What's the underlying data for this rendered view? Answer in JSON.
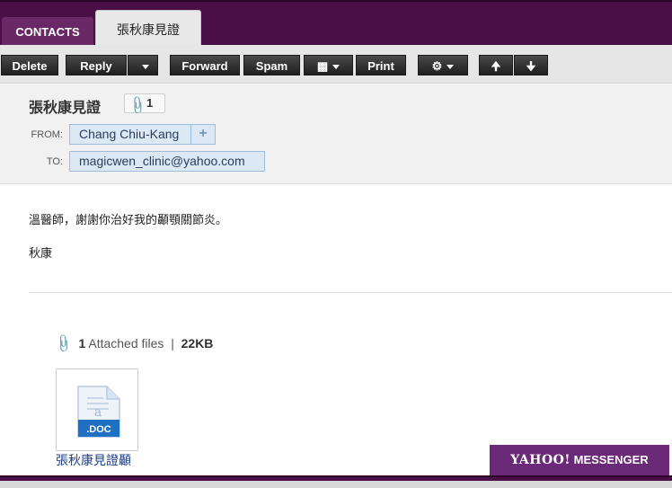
{
  "tabs": {
    "contacts": "CONTACTS",
    "active": "張秋康見證"
  },
  "toolbar": {
    "delete": "Delete",
    "reply": "Reply",
    "forward": "Forward",
    "spam": "Spam",
    "print": "Print"
  },
  "message": {
    "subject": "張秋康見證",
    "attachment_count": "1",
    "from_label": "FROM:",
    "from": "Chang Chiu-Kang",
    "add_contact": "+",
    "to_label": "TO:",
    "to": "magicwen_clinic@yahoo.com",
    "body_line1": "溫醫師，謝謝你治好我的顳顎關節炎。",
    "body_line2": "秋康"
  },
  "attachments": {
    "count": "1",
    "label": "Attached files",
    "separator": "|",
    "size": "22KB",
    "file_type": ".DOC",
    "file_name": "張秋康見證顳"
  },
  "footer": {
    "logo": "YAHOO!",
    "messenger": "MESSENGER"
  },
  "icons": [
    "reply-dropdown-caret",
    "move-folder-icon",
    "gear-icon",
    "arrow-up-icon",
    "arrow-down-icon",
    "paperclip-icon",
    "doc-file-icon"
  ]
}
